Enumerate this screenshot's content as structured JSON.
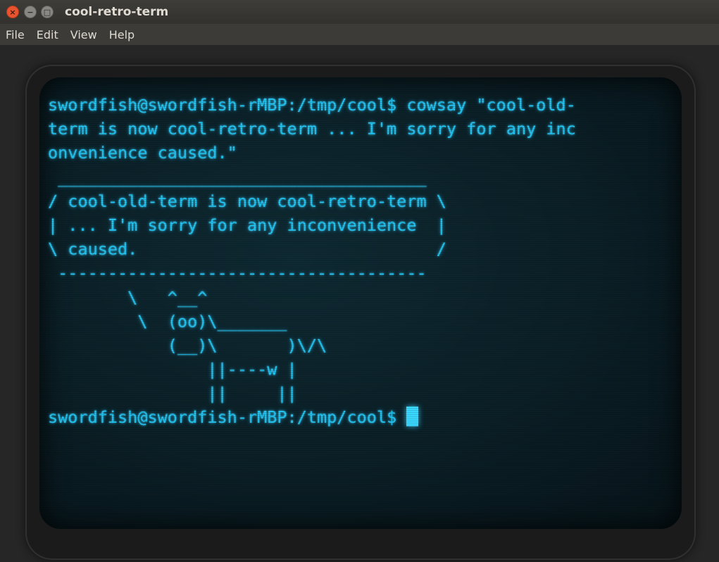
{
  "window": {
    "title": "cool-retro-term",
    "close_glyph": "×",
    "minimize_glyph": "−",
    "maximize_glyph": "□"
  },
  "menubar": {
    "items": [
      "File",
      "Edit",
      "View",
      "Help"
    ]
  },
  "terminal": {
    "text_color": "#22c4f2",
    "lines": [
      "swordfish@swordfish-rMBP:/tmp/cool$ cowsay \"cool-old-",
      "term is now cool-retro-term ... I'm sorry for any inc",
      "onvenience caused.\"",
      " _____________________________________",
      "/ cool-old-term is now cool-retro-term \\",
      "| ... I'm sorry for any inconvenience  |",
      "\\ caused.                              /",
      " -------------------------------------",
      "        \\   ^__^",
      "         \\  (oo)\\_______",
      "            (__)\\       )\\/\\",
      "                ||----w |",
      "                ||     ||"
    ],
    "prompt": "swordfish@swordfish-rMBP:/tmp/cool$ "
  }
}
